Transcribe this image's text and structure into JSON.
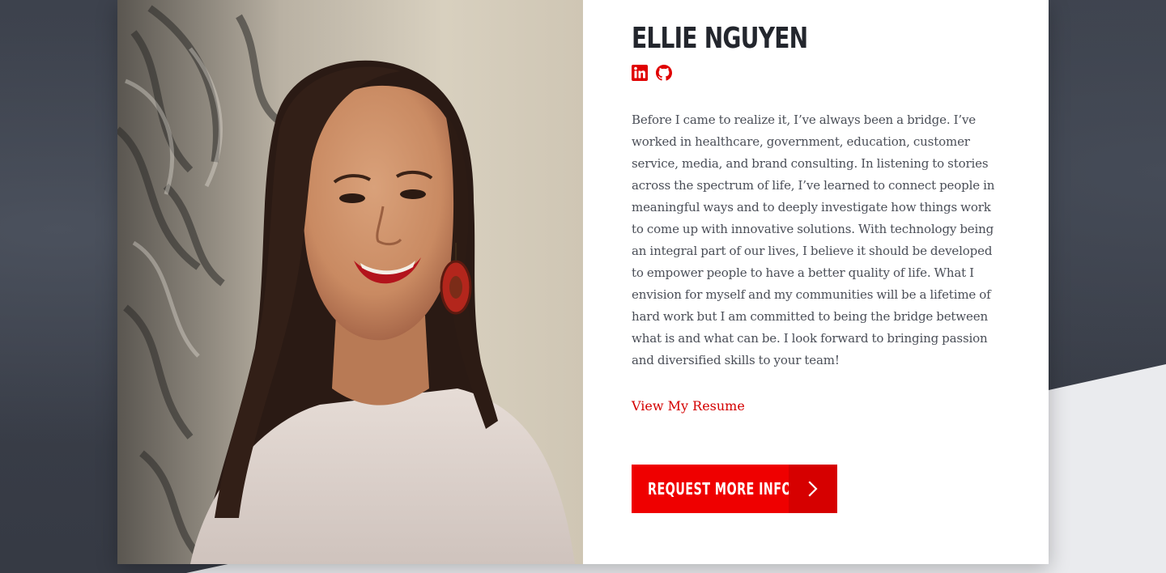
{
  "profile": {
    "name": "ELLIE NGUYEN",
    "photo_alt": "Portrait of Ellie Nguyen"
  },
  "socials": [
    {
      "label": "LinkedIn",
      "icon": "linkedin-icon"
    },
    {
      "label": "GitHub",
      "icon": "github-icon"
    }
  ],
  "bio": "Before I came to realize it, I’ve always been a bridge. I’ve worked in healthcare, government, education, customer service, media, and brand consulting. In listening to stories across the spectrum of life, I’ve learned to connect people in meaningful ways and to deeply investigate how things work to come up with innovative solutions. With technology being an integral part of our lives, I believe it should be developed to empower people to have a better quality of life. What I envision for myself and my communities will be a lifetime of hard work but I am committed to being the bridge between what is and what can be. I look forward to bringing passion and diversified skills to your team!",
  "resume_link": "View My Resume",
  "cta": {
    "label": "REQUEST MORE INFO",
    "icon": "chevron-right-icon"
  },
  "colors": {
    "accent": "#ef0000",
    "accent_dark": "#d60000",
    "heading": "#23262d",
    "body_text": "#4a4e57",
    "background": "#3b404b",
    "light_shape": "#eaebee"
  }
}
